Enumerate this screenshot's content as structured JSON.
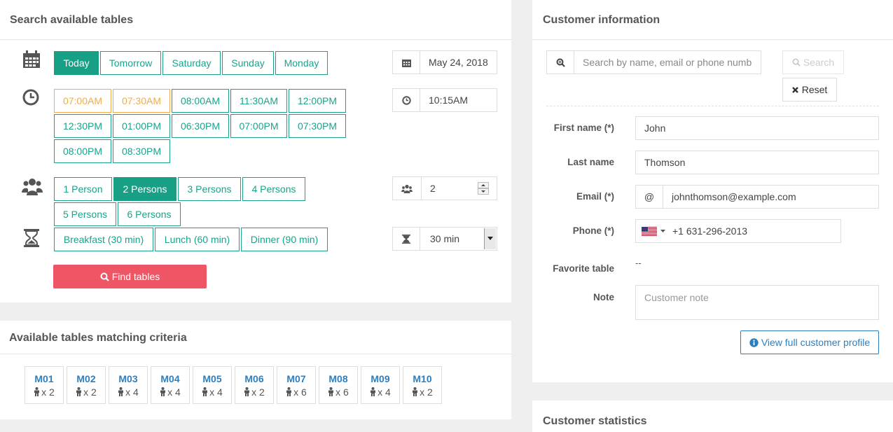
{
  "search_panel": {
    "title": "Search available tables",
    "days": [
      "Today",
      "Tomorrow",
      "Saturday",
      "Sunday",
      "Monday"
    ],
    "active_day": "Today",
    "date_value": "May 24, 2018",
    "times_row1": [
      "07:00AM",
      "07:30AM",
      "08:00AM",
      "11:30AM",
      "12:00PM"
    ],
    "times_row2": [
      "12:30PM",
      "01:00PM",
      "06:30PM",
      "07:00PM",
      "07:30PM"
    ],
    "times_row3": [
      "08:00PM",
      "08:30PM"
    ],
    "unavailable_times": [
      "07:00AM",
      "07:30AM"
    ],
    "time_value": "10:15AM",
    "persons_row1": [
      "1 Person",
      "2 Persons",
      "3 Persons",
      "4 Persons"
    ],
    "persons_row2": [
      "5 Persons",
      "6 Persons"
    ],
    "active_persons": "2 Persons",
    "persons_value": "2",
    "durations": [
      "Breakfast (30 min)",
      "Lunch (60 min)",
      "Dinner (90 min)"
    ],
    "duration_value": "30 min",
    "find_label": "Find tables"
  },
  "tables_panel": {
    "title": "Available tables matching criteria",
    "tables": [
      {
        "code": "M01",
        "cap": "x 2"
      },
      {
        "code": "M02",
        "cap": "x 2"
      },
      {
        "code": "M03",
        "cap": "x 4"
      },
      {
        "code": "M04",
        "cap": "x 4"
      },
      {
        "code": "M05",
        "cap": "x 4"
      },
      {
        "code": "M06",
        "cap": "x 2"
      },
      {
        "code": "M07",
        "cap": "x 6"
      },
      {
        "code": "M08",
        "cap": "x 6"
      },
      {
        "code": "M09",
        "cap": "x 4"
      },
      {
        "code": "M10",
        "cap": "x 2"
      }
    ]
  },
  "customer_panel": {
    "title": "Customer information",
    "search_placeholder": "Search by name, email or phone numb",
    "search_label": "Search",
    "reset_label": "Reset",
    "first_name_label": "First name (*)",
    "first_name": "John",
    "last_name_label": "Last name",
    "last_name": "Thomson",
    "email_label": "Email (*)",
    "email_prefix": "@",
    "email": "johnthomson@example.com",
    "phone_label": "Phone (*)",
    "phone": "+1 631-296-2013",
    "favorite_label": "Favorite table",
    "favorite": "--",
    "note_label": "Note",
    "note_placeholder": "Customer note",
    "profile_label": "View full customer profile"
  },
  "stats_panel": {
    "title": "Customer statistics"
  },
  "colors": {
    "accent": "#17a085",
    "warn": "#f0ad4e",
    "danger": "#ee5565",
    "link": "#2a7fc1"
  },
  "icons": [
    "calendar-icon",
    "clock-icon",
    "users-icon",
    "hourglass-icon",
    "search-icon",
    "times-icon",
    "info-icon",
    "person-icon",
    "us-flag-icon"
  ]
}
